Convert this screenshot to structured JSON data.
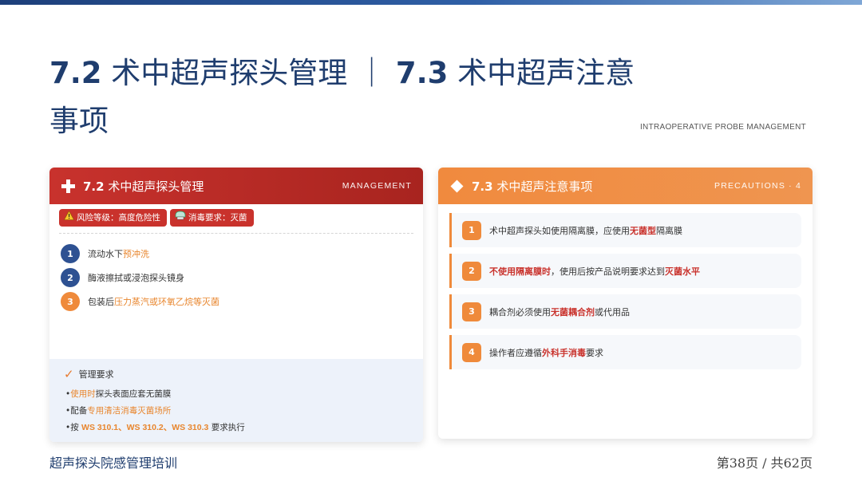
{
  "page": {
    "title_prefix_1": "7.2",
    "title_text_1": " 术中超声探头管理 ｜ ",
    "title_prefix_2": "7.3",
    "title_text_2": " 术中超声注意事项",
    "subtitle_en": "INTRAOPERATIVE PROBE MANAGEMENT"
  },
  "left_card": {
    "num": "7.2",
    "title": " 术中超声探头管理",
    "tag": "MANAGEMENT",
    "icon": "plus-cross-icon",
    "badges": [
      {
        "icon": "warning-icon",
        "text": "风险等级：高度危险性"
      },
      {
        "icon": "disinfect-icon",
        "text": "消毒要求：灭菌"
      }
    ],
    "steps": [
      {
        "num": "1",
        "pre": "流动水下",
        "hl": "预冲洗",
        "post": "",
        "color": "blue"
      },
      {
        "num": "2",
        "pre": "酶液擦拭或浸泡探头镜身",
        "hl": "",
        "post": "",
        "color": "blue"
      },
      {
        "num": "3",
        "pre": "包装后",
        "hl": "压力蒸汽或环氧乙烷等灭菌",
        "post": "",
        "color": "orange"
      }
    ],
    "management": {
      "title": "管理要求",
      "items": [
        {
          "pre": "•",
          "hl": "使用时",
          "post": "探头表面应套无菌膜"
        },
        {
          "pre": "•配备",
          "hl": "专用清洁消毒灭菌场所",
          "post": ""
        },
        {
          "pre": "•按 ",
          "hl": "WS 310.1、WS 310.2、WS 310.3",
          "post": " 要求执行"
        }
      ]
    }
  },
  "right_card": {
    "num": "7.3",
    "title": " 术中超声注意事项",
    "tag": "PRECAUTIONS · 4",
    "icon": "diamond-icon",
    "items": [
      {
        "num": "1",
        "parts": [
          {
            "t": "术中超声探头如使用隔离膜，应使用",
            "c": ""
          },
          {
            "t": "无菌型",
            "c": "r"
          },
          {
            "t": "隔离膜",
            "c": ""
          }
        ]
      },
      {
        "num": "2",
        "parts": [
          {
            "t": "不使用隔离膜时",
            "c": "r"
          },
          {
            "t": "，使用后按产品说明要求达到",
            "c": ""
          },
          {
            "t": "灭菌水平",
            "c": "r"
          }
        ]
      },
      {
        "num": "3",
        "parts": [
          {
            "t": "耦合剂必须使用",
            "c": ""
          },
          {
            "t": "无菌耦合剂",
            "c": "r"
          },
          {
            "t": "或代用品",
            "c": ""
          }
        ]
      },
      {
        "num": "4",
        "parts": [
          {
            "t": "操作者应遵循",
            "c": ""
          },
          {
            "t": "外科手消毒",
            "c": "r"
          },
          {
            "t": "要求",
            "c": ""
          }
        ]
      }
    ]
  },
  "footer": {
    "left": "超声探头院感管理培训",
    "right": "第38页 / 共62页"
  },
  "colors": {
    "navy": "#1f3d6e",
    "red": "#c9322c",
    "orange": "#ef8a3b",
    "light_blue_bg": "#edf2fa"
  }
}
